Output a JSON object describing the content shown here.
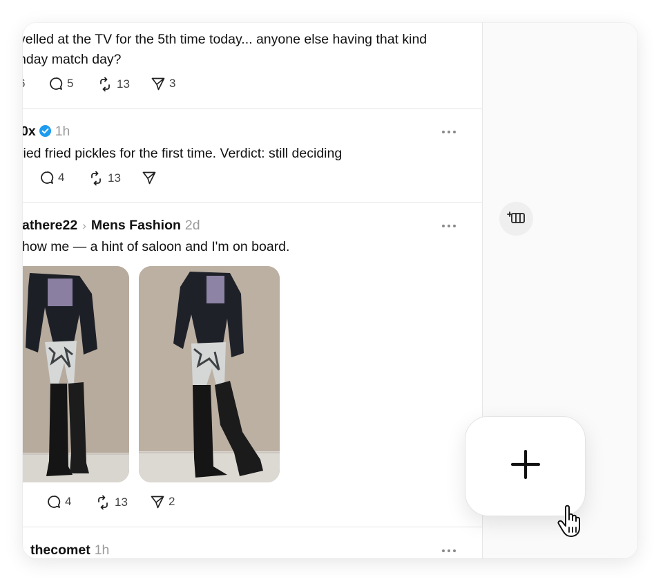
{
  "posts": [
    {
      "text_line1": "yelled at the TV for the 5th time today... anyone else having that kind",
      "text_line2": "nday match day?",
      "partial_like_count": "6",
      "replies": "5",
      "reposts": "13",
      "shares": "3"
    },
    {
      "handle": "0x",
      "time": "1h",
      "text": "ried fried pickles for the first time. Verdict: still deciding",
      "replies": "4",
      "reposts": "13",
      "shares": ""
    },
    {
      "handle": "athere22",
      "community": "Mens Fashion",
      "time": "2d",
      "text": "how me — a hint of saloon and I'm on board.",
      "replies": "4",
      "reposts": "13",
      "shares": "2"
    },
    {
      "handle": "thecomet",
      "time": "1h"
    }
  ],
  "icons": {
    "reply": "speech-bubble-icon",
    "repost": "repost-arrows-icon",
    "share": "paper-plane-icon",
    "more": "more-dots-icon",
    "verified": "verified-badge-icon",
    "add_column": "add-column-icon",
    "compose": "plus-icon",
    "cursor": "hand-pointer-icon"
  },
  "colors": {
    "verified": "#1d9bf0",
    "muted_text": "#9a9a9a",
    "divider": "#e4e4e4"
  }
}
